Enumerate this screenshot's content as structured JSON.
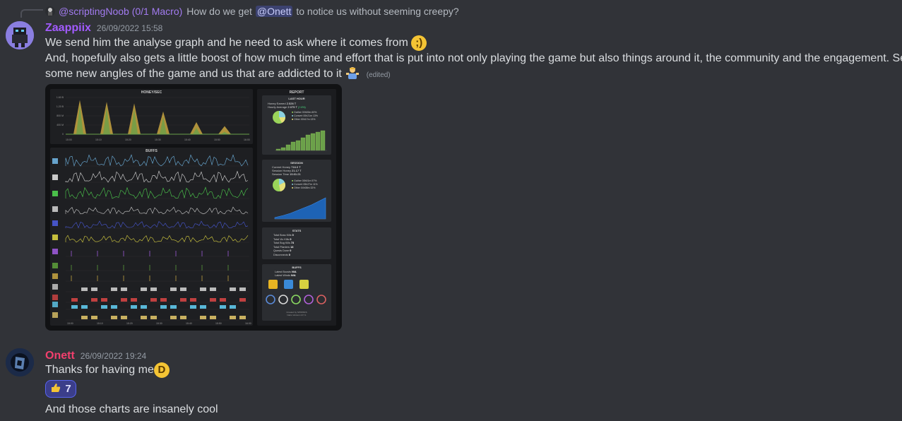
{
  "reply": {
    "username": "@scriptingNoob (0/1 Macro)",
    "text_before": "How do we get",
    "mention": "@Onett",
    "text_after": "to notice us without seeming creepy?"
  },
  "message1": {
    "username": "Zaappiix",
    "username_color": "#a25bff",
    "timestamp": "26/09/2022 15:58",
    "line1": "We send him the analyse graph and he need to ask where it comes from",
    "line2": "And, hopefully also gets a little boost of how much time and effort that is put into not only playing the game but also things around it, the community and the engagement. Seeing",
    "line3": "some new angles of the game and us that are addicted to it",
    "edited": "(edited)",
    "emoji1": "wink-emoji",
    "emoji2": "shrug-emoji"
  },
  "dashboard": {
    "honey_title": "HONEY/SEC",
    "honey_yticks": [
      "1.60 B",
      "1.20 B",
      "800 M",
      "400 M",
      "0"
    ],
    "time_ticks": [
      "15:00",
      "15:10",
      "15:20",
      "15:30",
      "15:40",
      "15:50",
      "16:00"
    ],
    "buffs_title": "BUFFS",
    "report_title": "REPORT",
    "last_hour_title": "LAST HOUR",
    "honey_earned": "Honey Earned",
    "honey_earned_val": "2.526 T",
    "hourly_average": "Hourly Average",
    "hourly_average_val": "2.075 T",
    "hourly_change": "(+4%)",
    "legend": [
      "Gather",
      "Convert",
      "Other"
    ],
    "lh_legend_vals": [
      "00h00m 60%",
      "00h21m 13%",
      "00h17m 13%"
    ],
    "session_title": "SESSION",
    "current_honey": "Current Honey",
    "current_honey_val": "716.0 T",
    "session_honey": "Session Honey",
    "session_honey_val": "21.17 T",
    "session_time": "Session Time",
    "session_time_val": "15:01:21",
    "ses_legend_vals": [
      "08h01m 57%",
      "05h27m 11%",
      "04h08m 32%"
    ],
    "stats_title": "STATS",
    "stats": [
      {
        "label": "Total Boss Kills",
        "val": "0"
      },
      {
        "label": "Total Vic Kills",
        "val": "0"
      },
      {
        "label": "Total Bug Kills",
        "val": "73"
      },
      {
        "label": "Total Planters",
        "val": "13"
      },
      {
        "label": "Quests Done",
        "val": "0"
      },
      {
        "label": "Disconnects",
        "val": "0"
      }
    ],
    "buffs_panel_title": "BUFFS",
    "latest_boosts": "Latest Boosts",
    "latest_boosts_val": "N/A",
    "latest_winds": "Latest Winds",
    "latest_winds_val": "N/A",
    "credits1": "Created by SP/RISKS",
    "credits2": "Natro Version v0.7.1"
  },
  "chart_data": [
    {
      "type": "area",
      "title": "HONEY/SEC",
      "x": [
        "15:00",
        "15:10",
        "15:20",
        "15:30",
        "15:40",
        "15:50",
        "16:00"
      ],
      "ylabel": "",
      "ylim": [
        0,
        1600000000
      ],
      "series": [
        {
          "values": [
            0,
            1500000000,
            1450000000,
            1350000000,
            600000000,
            500000000,
            200000000
          ]
        }
      ]
    }
  ],
  "message2": {
    "username": "Onett",
    "username_color": "#f23f6d",
    "timestamp": "26/09/2022 19:24",
    "line1": "Thanks for having me",
    "emoji": "grin-emoji",
    "reaction_emoji": "thumbs-up",
    "reaction_count": "7",
    "line2": "And those charts are insanely cool"
  }
}
